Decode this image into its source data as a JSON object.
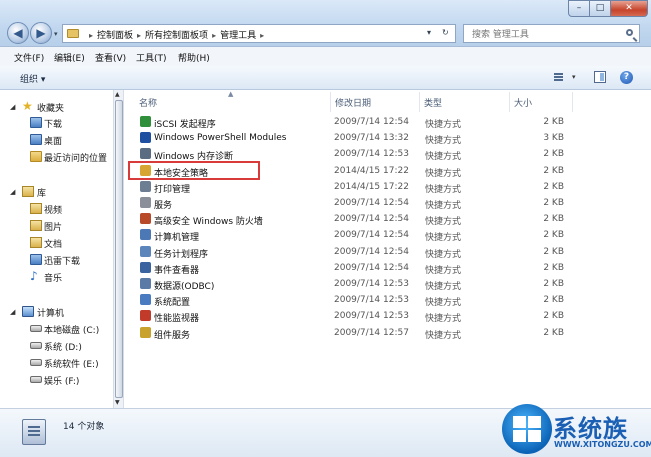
{
  "window": {
    "minimize": "–",
    "maximize": "□",
    "close": "✕"
  },
  "address": {
    "crumbs": [
      "控制面板",
      "所有控制面板项",
      "管理工具"
    ],
    "dropdown": "▾",
    "refresh": "↻"
  },
  "search": {
    "placeholder": "搜索 管理工具"
  },
  "menu": [
    "文件(F)",
    "编辑(E)",
    "查看(V)",
    "工具(T)",
    "帮助(H)"
  ],
  "toolbar": {
    "organize": "组织 ▾",
    "help": "?",
    "views_drop": "▾"
  },
  "nav": {
    "favorites": "收藏夹",
    "favorites_items": [
      "下载",
      "桌面",
      "最近访问的位置"
    ],
    "libraries": "库",
    "libraries_items": [
      "视频",
      "图片",
      "文档",
      "迅雷下载",
      "音乐"
    ],
    "computer": "计算机",
    "drives": [
      "本地磁盘 (C:)",
      "系统 (D:)",
      "系统软件 (E:)",
      "娱乐 (F:)"
    ]
  },
  "columns": {
    "name": "名称",
    "date": "修改日期",
    "type": "类型",
    "size": "大小"
  },
  "files": [
    {
      "name": "iSCSI 发起程序",
      "date": "2009/7/14 12:54",
      "type": "快捷方式",
      "size": "2 KB",
      "icon": "globe-icon",
      "color": "#2f8f3a"
    },
    {
      "name": "Windows PowerShell Modules",
      "date": "2009/7/14 13:32",
      "type": "快捷方式",
      "size": "3 KB",
      "icon": "powershell-icon",
      "color": "#1f4fa0"
    },
    {
      "name": "Windows 内存诊断",
      "date": "2009/7/14 12:53",
      "type": "快捷方式",
      "size": "2 KB",
      "icon": "memory-icon",
      "color": "#5a6c82"
    },
    {
      "name": "本地安全策略",
      "date": "2014/4/15 17:22",
      "type": "快捷方式",
      "size": "2 KB",
      "icon": "security-policy-icon",
      "color": "#d7a531"
    },
    {
      "name": "打印管理",
      "date": "2014/4/15 17:22",
      "type": "快捷方式",
      "size": "2 KB",
      "icon": "printer-icon",
      "color": "#6d7d92"
    },
    {
      "name": "服务",
      "date": "2009/7/14 12:54",
      "type": "快捷方式",
      "size": "2 KB",
      "icon": "services-icon",
      "color": "#8a8f99"
    },
    {
      "name": "高级安全 Windows 防火墙",
      "date": "2009/7/14 12:54",
      "type": "快捷方式",
      "size": "2 KB",
      "icon": "firewall-icon",
      "color": "#b84a2a"
    },
    {
      "name": "计算机管理",
      "date": "2009/7/14 12:54",
      "type": "快捷方式",
      "size": "2 KB",
      "icon": "computer-management-icon",
      "color": "#4c78b5"
    },
    {
      "name": "任务计划程序",
      "date": "2009/7/14 12:54",
      "type": "快捷方式",
      "size": "2 KB",
      "icon": "task-scheduler-icon",
      "color": "#5c86bb"
    },
    {
      "name": "事件查看器",
      "date": "2009/7/14 12:54",
      "type": "快捷方式",
      "size": "2 KB",
      "icon": "event-viewer-icon",
      "color": "#3a63a0"
    },
    {
      "name": "数据源(ODBC)",
      "date": "2009/7/14 12:53",
      "type": "快捷方式",
      "size": "2 KB",
      "icon": "odbc-icon",
      "color": "#5b7aa6"
    },
    {
      "name": "系统配置",
      "date": "2009/7/14 12:53",
      "type": "快捷方式",
      "size": "2 KB",
      "icon": "system-config-icon",
      "color": "#4a7bc0"
    },
    {
      "name": "性能监视器",
      "date": "2009/7/14 12:53",
      "type": "快捷方式",
      "size": "2 KB",
      "icon": "performance-monitor-icon",
      "color": "#c23a2a"
    },
    {
      "name": "组件服务",
      "date": "2009/7/14 12:57",
      "type": "快捷方式",
      "size": "2 KB",
      "icon": "component-services-icon",
      "color": "#c9a22d"
    }
  ],
  "status": {
    "count": "14 个对象"
  },
  "watermark": {
    "brand": "系统族",
    "url": "WWW.XITONGZU.COM"
  }
}
